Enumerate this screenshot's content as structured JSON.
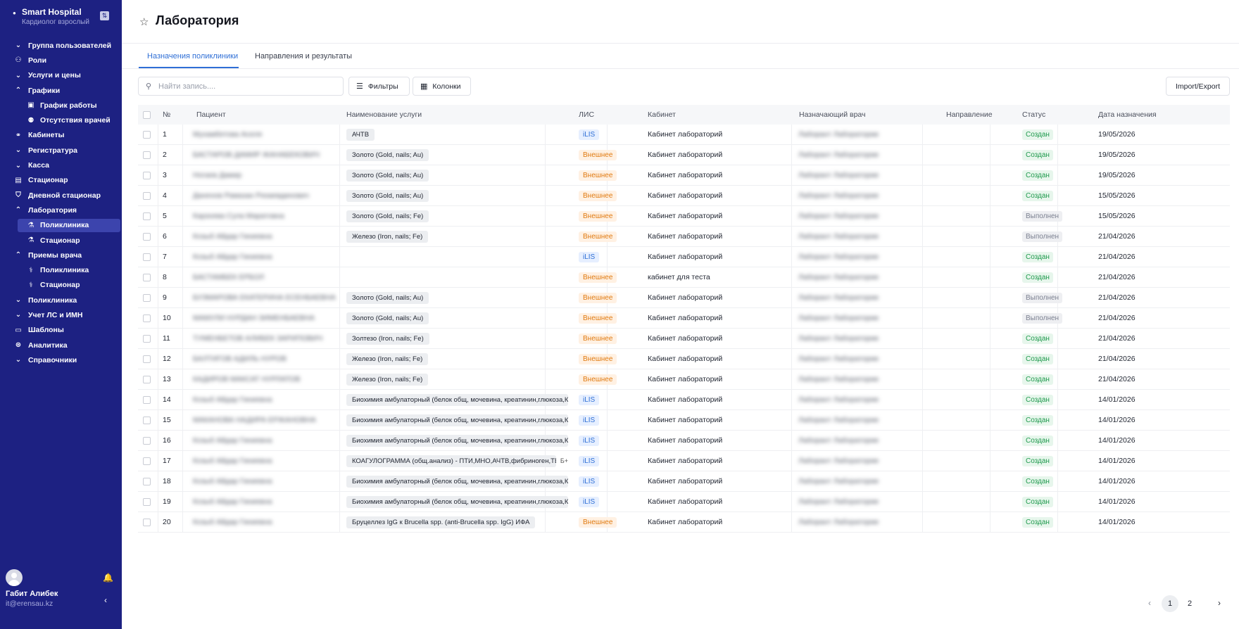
{
  "sidebar": {
    "app_name": "Smart Hospital",
    "role": "Кардиолог взрослый",
    "items": [
      {
        "label": "Группа пользователей",
        "icon": "chevron-down-icon",
        "level": 0
      },
      {
        "label": "Роли",
        "icon": "users-icon",
        "level": 0
      },
      {
        "label": "Услуги и цены",
        "icon": "chevron-down-icon",
        "level": 0
      },
      {
        "label": "Графики",
        "icon": "chevron-up-icon",
        "level": 0
      },
      {
        "label": "График работы",
        "icon": "calendar-icon",
        "level": 1
      },
      {
        "label": "Отсутствия врачей",
        "icon": "user-off-icon",
        "level": 1
      },
      {
        "label": "Кабинеты",
        "icon": "link-icon",
        "level": 0
      },
      {
        "label": "Регистратура",
        "icon": "chevron-down-icon",
        "level": 0
      },
      {
        "label": "Касса",
        "icon": "chevron-down-icon",
        "level": 0
      },
      {
        "label": "Стационар",
        "icon": "table-icon",
        "level": 0
      },
      {
        "label": "Дневной стационар",
        "icon": "shield-icon",
        "level": 0
      },
      {
        "label": "Лаборатория",
        "icon": "chevron-up-icon",
        "level": 0
      },
      {
        "label": "Поликлиника",
        "icon": "flask-icon",
        "level": 1,
        "active": true
      },
      {
        "label": "Стационар",
        "icon": "flask-icon",
        "level": 1
      },
      {
        "label": "Приемы врача",
        "icon": "chevron-up-icon",
        "level": 0
      },
      {
        "label": "Поликлиника",
        "icon": "stethoscope-icon",
        "level": 1
      },
      {
        "label": "Стационар",
        "icon": "stethoscope-icon",
        "level": 1
      },
      {
        "label": "Поликлиника",
        "icon": "chevron-down-icon",
        "level": 0
      },
      {
        "label": "Учет ЛС и ИМН",
        "icon": "chevron-down-icon",
        "level": 0
      },
      {
        "label": "Шаблоны",
        "icon": "folder-icon",
        "level": 0
      },
      {
        "label": "Аналитика",
        "icon": "dollar-circle-icon",
        "level": 0
      },
      {
        "label": "Справочники",
        "icon": "chevron-down-icon",
        "level": 0
      }
    ],
    "user": {
      "name": "Габит Алибек",
      "email": "it@erensau.kz"
    }
  },
  "header": {
    "title": "Лаборатория"
  },
  "tabs": [
    {
      "label": "Назначения поликлиники",
      "active": true
    },
    {
      "label": "Направления и результаты",
      "active": false
    }
  ],
  "toolbar": {
    "search_placeholder": "Найти запись....",
    "filters_label": "Фильтры",
    "columns_label": "Колонки",
    "import_export_label": "Import/Export"
  },
  "table": {
    "columns": [
      "№",
      "Пациент",
      "Наименование услуги",
      "ЛИС",
      "Кабинет",
      "Назначающий врач",
      "Направление",
      "Статус",
      "Дата назначения"
    ],
    "rows": [
      {
        "num": "1",
        "patient": "Мухамбетова Аселя",
        "service": "АЧТВ",
        "lis": "iLIS",
        "cabinet": "Кабинет лабораторий",
        "doctor": "Лаборант Лаборатории",
        "direction": "",
        "status": "Создан",
        "date": "19/05/2026"
      },
      {
        "num": "2",
        "patient": "БАСТАРОВ ДАМИР ЖАНАБЕКОВИЧ",
        "service": "Золото (Gold, nails; Au)",
        "lis": "Внешнее",
        "cabinet": "Кабинет лабораторий",
        "doctor": "Лаборант Лаборатории",
        "direction": "",
        "status": "Создан",
        "date": "19/05/2026"
      },
      {
        "num": "3",
        "patient": "Ногаев Дамир",
        "service": "Золото (Gold, nails; Au)",
        "lis": "Внешнее",
        "cabinet": "Кабинет лабораторий",
        "doctor": "Лаборант Лаборатории",
        "direction": "",
        "status": "Создан",
        "date": "19/05/2026"
      },
      {
        "num": "4",
        "patient": "Даненов Рамазан Ризаевдинович",
        "service": "Золото (Gold, nails; Au)",
        "lis": "Внешнее",
        "cabinet": "Кабинет лабораторий",
        "doctor": "Лаборант Лаборатории",
        "direction": "",
        "status": "Создан",
        "date": "15/05/2026"
      },
      {
        "num": "5",
        "patient": "Карзоева Сула Маратовна",
        "service": "Золото (Gold, nails; Fe)",
        "lis": "Внешнее",
        "cabinet": "Кабинет лабораторий",
        "doctor": "Лаборант Лаборатории",
        "direction": "",
        "status": "Выполнен",
        "date": "15/05/2026"
      },
      {
        "num": "6",
        "patient": "Козыб Айдар Гиниевна",
        "service": "Железо (Iron, nails; Fe)",
        "lis": "Внешнее",
        "cabinet": "Кабинет лабораторий",
        "doctor": "Лаборант Лаборатории",
        "direction": "",
        "status": "Выполнен",
        "date": "21/04/2026"
      },
      {
        "num": "7",
        "patient": "Козыб Айдар Гиниевна",
        "service": "",
        "lis": "iLIS",
        "cabinet": "Кабинет лабораторий",
        "doctor": "Лаборант Лаборатории",
        "direction": "",
        "status": "Создан",
        "date": "21/04/2026"
      },
      {
        "num": "8",
        "patient": "БАСТАМБЕК ЕРБОЛ",
        "service": "",
        "lis": "Внешнее",
        "cabinet": "кабинет для теста",
        "doctor": "Лаборант Лаборатории",
        "direction": "",
        "status": "Создан",
        "date": "21/04/2026"
      },
      {
        "num": "9",
        "patient": "БУЗМАРОВА ЕКАТЕРИНА ЕСЕНБАЕВНА",
        "service": "Золото (Gold, nails; Au)",
        "lis": "Внешнее",
        "cabinet": "Кабинет лабораторий",
        "doctor": "Лаборант Лаборатории",
        "direction": "",
        "status": "Выполнен",
        "date": "21/04/2026"
      },
      {
        "num": "10",
        "patient": "МАМУЛИ НУРДАН ЗИМЕНБАЕВНА",
        "service": "Золото (Gold, nails; Au)",
        "lis": "Внешнее",
        "cabinet": "Кабинет лабораторий",
        "doctor": "Лаборант Лаборатории",
        "direction": "",
        "status": "Выполнен",
        "date": "21/04/2026"
      },
      {
        "num": "11",
        "patient": "ТУМЕНБЕТОВ АЛИБЕК ЗАРИПОВИЧ",
        "service": "Золтезо (Iron, nails; Fe)",
        "lis": "Внешнее",
        "cabinet": "Кабинет лабораторий",
        "doctor": "Лаборант Лаборатории",
        "direction": "",
        "status": "Создан",
        "date": "21/04/2026"
      },
      {
        "num": "12",
        "patient": "БАЛТИГОВ АДИЛЬ НУРОВ",
        "service": "Железо (Iron, nails; Fe)",
        "lis": "Внешнее",
        "cabinet": "Кабинет лабораторий",
        "doctor": "Лаборант Лаборатории",
        "direction": "",
        "status": "Создан",
        "date": "21/04/2026"
      },
      {
        "num": "13",
        "patient": "КАДИРОВ МАКСАТ НУРЛАТОВ",
        "service": "Железо (Iron, nails; Fe)",
        "lis": "Внешнее",
        "cabinet": "Кабинет лабораторий",
        "doctor": "Лаборант Лаборатории",
        "direction": "",
        "status": "Создан",
        "date": "21/04/2026"
      },
      {
        "num": "14",
        "patient": "Козыб Айдар Гиниевна",
        "service": "Биохимия амбулаторный (белок общ, мочевина, креатинин,глюкоза,К,Na",
        "lis": "iLIS",
        "cabinet": "Кабинет лабораторий",
        "doctor": "Лаборант Лаборатории",
        "direction": "",
        "status": "Создан",
        "date": "14/01/2026"
      },
      {
        "num": "15",
        "patient": "МАКАНОВА НАДИРА ЕРЖАНОВНА",
        "service": "Биохимия амбулаторный (белок общ, мочевина, креатинин,глюкоза,К,Na",
        "lis": "iLIS",
        "cabinet": "Кабинет лабораторий",
        "doctor": "Лаборант Лаборатории",
        "direction": "",
        "status": "Создан",
        "date": "14/01/2026"
      },
      {
        "num": "16",
        "patient": "Козыб Айдар Гиниевна",
        "service": "Биохимия амбулаторный (белок общ, мочевина, креатинин,глюкоза,К,Na",
        "lis": "iLIS",
        "cabinet": "Кабинет лабораторий",
        "doctor": "Лаборант Лаборатории",
        "direction": "",
        "status": "Создан",
        "date": "14/01/2026"
      },
      {
        "num": "17",
        "patient": "Козыб Айдар Гиниевна",
        "service": "КОАГУЛОГРАММА (общ.анализ) - ПТИ,МНО,АЧТВ,фибриноген,ТВ",
        "service_extra": "Б+",
        "lis": "iLIS",
        "cabinet": "Кабинет лабораторий",
        "doctor": "Лаборант Лаборатории",
        "direction": "",
        "status": "Создан",
        "date": "14/01/2026"
      },
      {
        "num": "18",
        "patient": "Козыб Айдар Гиниевна",
        "service": "Биохимия амбулаторный (белок общ, мочевина, креатинин,глюкоза,К,Na",
        "lis": "iLIS",
        "cabinet": "Кабинет лабораторий",
        "doctor": "Лаборант Лаборатории",
        "direction": "",
        "status": "Создан",
        "date": "14/01/2026"
      },
      {
        "num": "19",
        "patient": "Козыб Айдар Гиниевна",
        "service": "Биохимия амбулаторный (белок общ, мочевина, креатинин,глюкоза,К,Na",
        "lis": "iLIS",
        "cabinet": "Кабинет лабораторий",
        "doctor": "Лаборант Лаборатории",
        "direction": "",
        "status": "Создан",
        "date": "14/01/2026"
      },
      {
        "num": "20",
        "patient": "Козыб Айдар Гиниевна",
        "service": "Бруцеллез IgG к Brucella spp. (anti-Brucella spp. IgG) ИФА",
        "lis": "Внешнее",
        "cabinet": "Кабинет лабораторий",
        "doctor": "Лаборант Лаборатории",
        "direction": "",
        "status": "Создан",
        "date": "14/01/2026"
      }
    ]
  },
  "pagination": {
    "pages": [
      "1",
      "2"
    ],
    "current": "1"
  },
  "colors": {
    "sidebar_bg": "#1d2182",
    "accent": "#2f6fd6",
    "created": "#1f9a4d",
    "external": "#e07a10"
  }
}
